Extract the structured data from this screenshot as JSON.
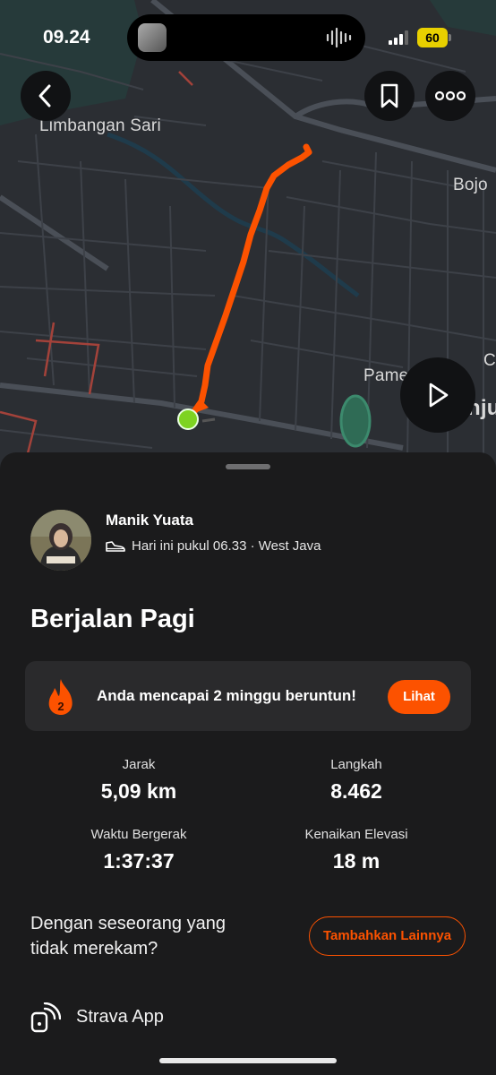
{
  "status_bar": {
    "time": "09.24",
    "battery": "60"
  },
  "map": {
    "labels": {
      "limbangan_sari": "Limbangan Sari",
      "bojo": "Bojo",
      "pame": "Pame",
      "c": "C",
      "nju": "nju"
    },
    "route_color": "#fc5200",
    "start_marker_color": "#7ed321"
  },
  "toolbar": {
    "back_icon": "chevron-left-icon",
    "bookmark_icon": "bookmark-icon",
    "more_icon": "more-dots-icon",
    "play_icon": "play-icon"
  },
  "activity": {
    "athlete_name": "Manik Yuata",
    "meta": "Hari ini pukul 06.33 · West Java",
    "title": "Berjalan Pagi"
  },
  "streak": {
    "count": "2",
    "message": "Anda mencapai 2 minggu beruntun!",
    "button": "Lihat"
  },
  "stats": [
    {
      "label": "Jarak",
      "value": "5,09 km"
    },
    {
      "label": "Langkah",
      "value": "8.462"
    },
    {
      "label": "Waktu Bergerak",
      "value": "1:37:37"
    },
    {
      "label": "Kenaikan Elevasi",
      "value": "18 m"
    }
  ],
  "partner": {
    "question": "Dengan seseorang yang tidak merekam?",
    "button": "Tambahkan Lainnya"
  },
  "device": {
    "name": "Strava App"
  },
  "colors": {
    "accent": "#fc5200",
    "sheet": "#1b1b1c",
    "card": "#2a2a2c"
  }
}
